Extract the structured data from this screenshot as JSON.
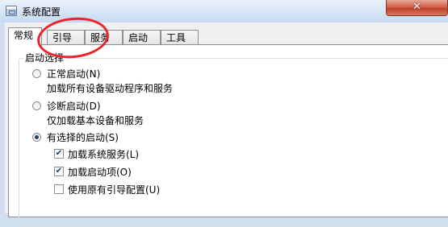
{
  "window": {
    "title": "系统配置",
    "close_symbol": "✕",
    "icon": "msconfig-app-icon"
  },
  "tabs": [
    {
      "label": "常规",
      "active": true
    },
    {
      "label": "引导",
      "active": false
    },
    {
      "label": "服务",
      "active": false
    },
    {
      "label": "启动",
      "active": false
    },
    {
      "label": "工具",
      "active": false
    }
  ],
  "startup_selection": {
    "legend": "启动选择",
    "normal": {
      "label": "正常启动(N)",
      "description": "加载所有设备驱动程序和服务",
      "selected": false
    },
    "diagnostic": {
      "label": "诊断启动(D)",
      "description": "仅加载基本设备和服务",
      "selected": false
    },
    "selective": {
      "label": "有选择的启动(S)",
      "selected": true,
      "options": [
        {
          "label": "加载系统服务(L)",
          "checked": true
        },
        {
          "label": "加载启动项(O)",
          "checked": true
        },
        {
          "label": "使用原有引导配置(U)",
          "checked": false
        }
      ]
    }
  },
  "annotation": {
    "color": "#e8262c"
  }
}
